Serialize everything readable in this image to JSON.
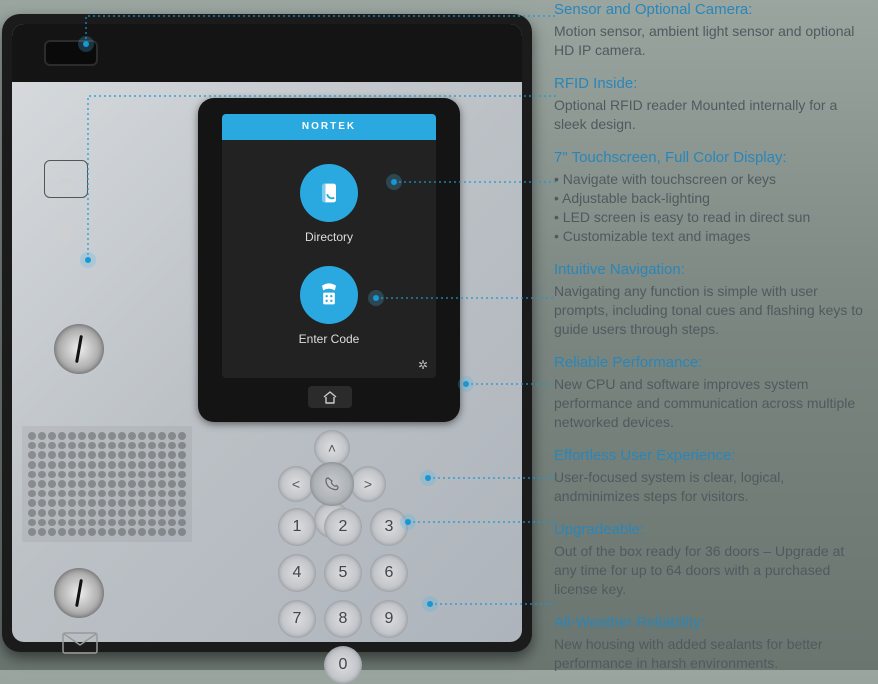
{
  "device": {
    "brand": "NORTEK",
    "apps": {
      "directory_label": "Directory",
      "entercode_label": "Enter Code"
    },
    "keypad": [
      "1",
      "2",
      "3",
      "4",
      "5",
      "6",
      "7",
      "8",
      "9",
      "0"
    ]
  },
  "callouts": [
    {
      "title": "Sensor and Optional Camera:",
      "body": "Motion sensor, ambient light sensor and optional HD IP camera."
    },
    {
      "title": "RFID Inside:",
      "body": "Optional RFID reader Mounted internally for a sleek design."
    },
    {
      "title": "7\" Touchscreen, Full Color Display:",
      "bullets": [
        "Navigate with touchscreen or keys",
        "Adjustable back-lighting",
        "LED screen is easy to read in direct sun",
        "Customizable text and images"
      ]
    },
    {
      "title": "Intuitive Navigation:",
      "body": "Navigating any function is simple with user prompts, including tonal cues and flashing keys to guide users through steps."
    },
    {
      "title": "Reliable Performance:",
      "body": "New CPU and software improves system performance and communication across multiple networked devices."
    },
    {
      "title": "Effortless User Experience:",
      "body": "User-focused system is clear, logical, andminimizes steps for visitors."
    },
    {
      "title": "Upgradeable:",
      "body": "Out of the box ready for 36 doors – Upgrade at any time for up to 64 doors with a purchased license key."
    },
    {
      "title": "All-Weather Reliability:",
      "body": "New housing with added sealants for better performance in harsh environments."
    }
  ]
}
